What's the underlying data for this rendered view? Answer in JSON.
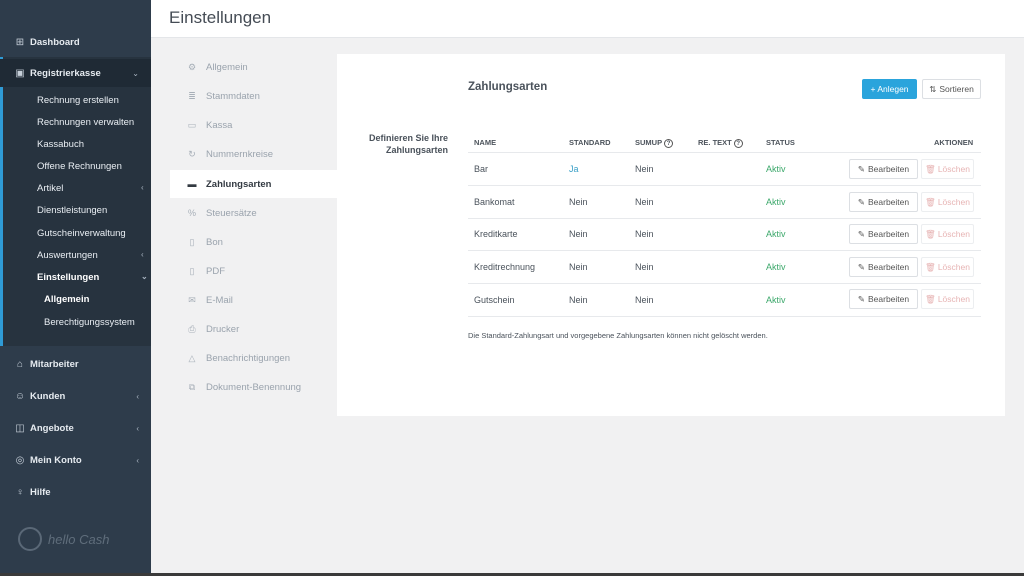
{
  "header": {
    "title": "Einstellungen"
  },
  "sidebar": {
    "dashboard": "Dashboard",
    "registrierkasse": "Registrierkasse",
    "reg_items": [
      "Rechnung erstellen",
      "Rechnungen verwalten",
      "Kassabuch",
      "Offene Rechnungen",
      "Artikel",
      "Dienstleistungen",
      "Gutscheinverwaltung",
      "Auswertungen",
      "Einstellungen"
    ],
    "einstellungen_items": [
      "Allgemein",
      "Berechtigungssystem"
    ],
    "mitarbeiter": "Mitarbeiter",
    "kunden": "Kunden",
    "angebote": "Angebote",
    "mein_konto": "Mein Konto",
    "hilfe": "Hilfe",
    "logo_text": "hello Cash"
  },
  "settings_menu": [
    {
      "label": "Allgemein",
      "icon": "gear-icon"
    },
    {
      "label": "Stammdaten",
      "icon": "database-icon"
    },
    {
      "label": "Kassa",
      "icon": "monitor-icon"
    },
    {
      "label": "Nummernkreise",
      "icon": "refresh-icon"
    },
    {
      "label": "Zahlungsarten",
      "icon": "credit-card-icon"
    },
    {
      "label": "Steuersätze",
      "icon": "percent-icon"
    },
    {
      "label": "Bon",
      "icon": "file-icon"
    },
    {
      "label": "PDF",
      "icon": "file-pdf-icon"
    },
    {
      "label": "E-Mail",
      "icon": "envelope-icon"
    },
    {
      "label": "Drucker",
      "icon": "printer-icon"
    },
    {
      "label": "Benachrichtigungen",
      "icon": "bell-icon"
    },
    {
      "label": "Dokument-Benennung",
      "icon": "sitemap-icon"
    }
  ],
  "card": {
    "title": "Zahlungsarten",
    "add_label": "+ Anlegen",
    "sort_label": "Sortieren",
    "description": "Definieren Sie Ihre Zahlungsarten",
    "columns": {
      "name": "NAME",
      "standard": "STANDARD",
      "sumup": "SUMUP",
      "re_text": "RE. TEXT",
      "status": "STATUS",
      "aktionen": "AKTIONEN"
    },
    "edit_label": "Bearbeiten",
    "delete_label": "Löschen",
    "rows": [
      {
        "name": "Bar",
        "standard": "Ja",
        "sumup": "Nein",
        "status": "Aktiv"
      },
      {
        "name": "Bankomat",
        "standard": "Nein",
        "sumup": "Nein",
        "status": "Aktiv"
      },
      {
        "name": "Kreditkarte",
        "standard": "Nein",
        "sumup": "Nein",
        "status": "Aktiv"
      },
      {
        "name": "Kreditrechnung",
        "standard": "Nein",
        "sumup": "Nein",
        "status": "Aktiv"
      },
      {
        "name": "Gutschein",
        "standard": "Nein",
        "sumup": "Nein",
        "status": "Aktiv"
      }
    ],
    "note": "Die Standard-Zahlungsart und vorgegebene Zahlungsarten können nicht gelöscht werden."
  },
  "colors": {
    "sidebar_bg": "#2e3c4b",
    "accent": "#2aa4dc",
    "status_active": "#3ca86b"
  }
}
